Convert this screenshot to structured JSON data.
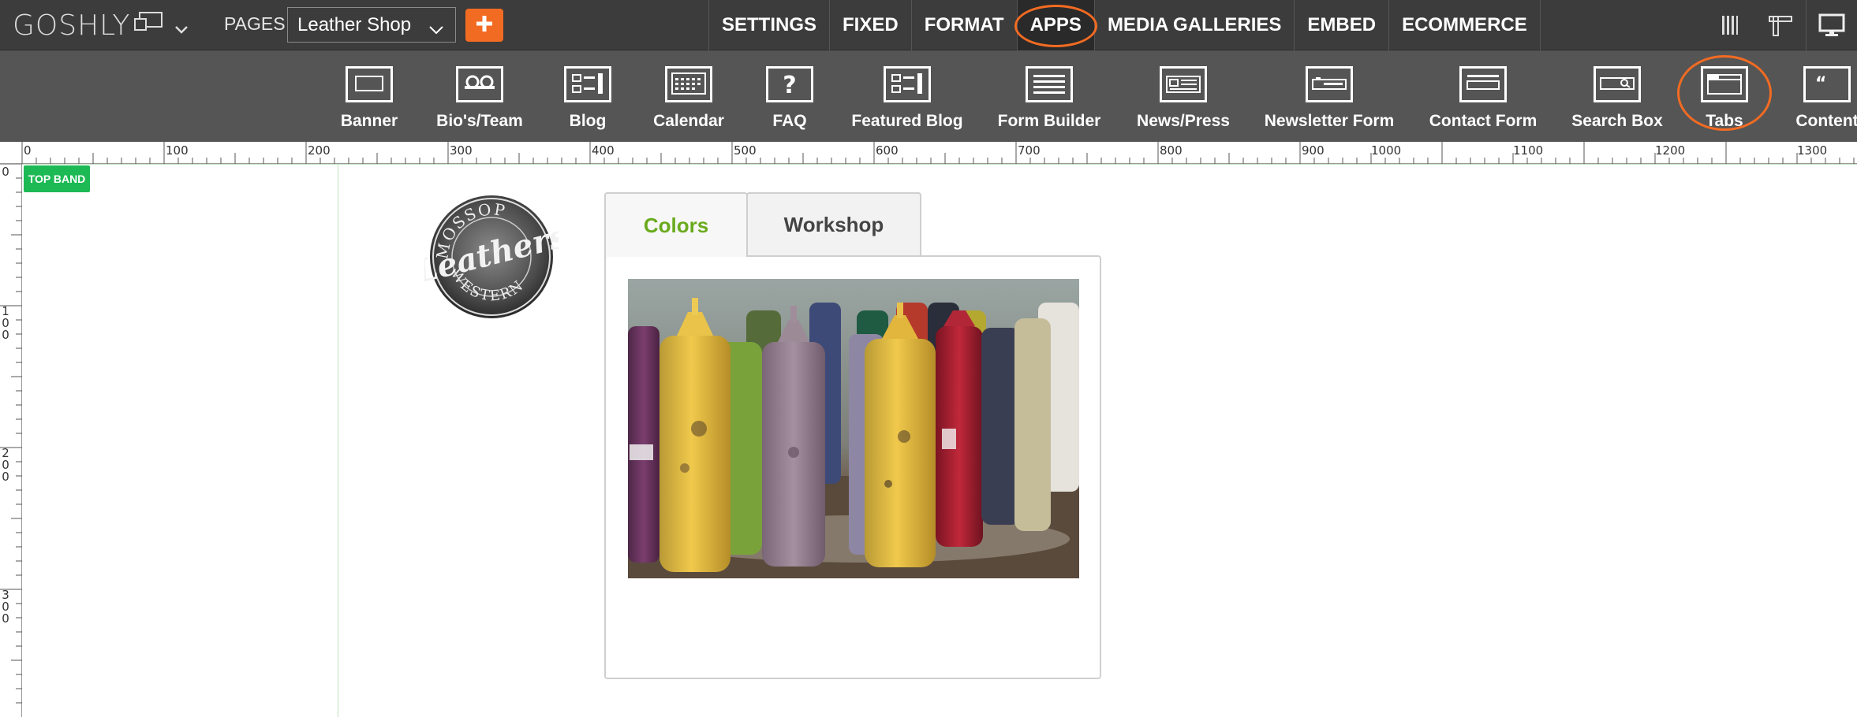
{
  "topbar": {
    "logo_text": "GOSHLY",
    "pages_label": "PAGES",
    "page_select_value": "Leather Shop",
    "add_page_icon": "plus-icon",
    "menu": [
      {
        "label": "SETTINGS",
        "active": false
      },
      {
        "label": "FIXED",
        "active": false
      },
      {
        "label": "FORMAT",
        "active": false
      },
      {
        "label": "APPS",
        "active": true,
        "highlighted": true
      },
      {
        "label": "MEDIA GALLERIES",
        "active": false
      },
      {
        "label": "EMBED",
        "active": false
      },
      {
        "label": "ECOMMERCE",
        "active": false
      }
    ],
    "right_icons": [
      "grid-columns-icon",
      "ruler-icon",
      "desktop-view-icon"
    ]
  },
  "apps": [
    {
      "label": "Banner",
      "icon": "banner-icon"
    },
    {
      "label": "Bio's/Team",
      "icon": "team-icon"
    },
    {
      "label": "Blog",
      "icon": "blog-icon"
    },
    {
      "label": "Calendar",
      "icon": "calendar-icon"
    },
    {
      "label": "FAQ",
      "icon": "faq-icon"
    },
    {
      "label": "Featured Blog",
      "icon": "featured-blog-icon"
    },
    {
      "label": "Form Builder",
      "icon": "form-builder-icon"
    },
    {
      "label": "News/Press",
      "icon": "news-icon"
    },
    {
      "label": "Newsletter Form",
      "icon": "newsletter-icon"
    },
    {
      "label": "Contact Form",
      "icon": "contact-form-icon"
    },
    {
      "label": "Search Box",
      "icon": "search-box-icon"
    },
    {
      "label": "Tabs",
      "icon": "tabs-icon",
      "highlighted": true
    },
    {
      "label": "Content",
      "icon": "content-icon"
    }
  ],
  "ruler": {
    "h_labels": [
      "0",
      "100",
      "200",
      "300",
      "400",
      "500",
      "600",
      "700",
      "800",
      "900",
      "1000",
      "1100",
      "1200",
      "1300"
    ],
    "v_labels": [
      "0",
      "100",
      "200",
      "300"
    ]
  },
  "canvas": {
    "band_label": "TOP BAND",
    "logo_text": [
      "MOSSOP",
      "Leathers",
      "WESTERN"
    ],
    "tabs": [
      {
        "label": "Colors",
        "active": true
      },
      {
        "label": "Workshop",
        "active": false
      }
    ],
    "image_alt": "paint bottles photo"
  },
  "colors": {
    "accent": "#f26b22",
    "active_tab": "#6aab1d",
    "band": "#1db954",
    "topbar": "#3c3c3c",
    "appbar": "#555555"
  }
}
